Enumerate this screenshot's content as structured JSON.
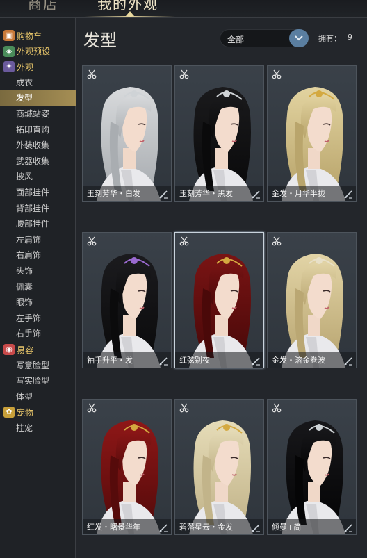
{
  "top_tabs": [
    {
      "label": "商店"
    },
    {
      "label": "我的外观"
    }
  ],
  "sidebar": {
    "categories": [
      {
        "label": "购物车",
        "icon": "cart-icon",
        "color": "#c87a3a"
      },
      {
        "label": "外观预设",
        "icon": "preset-icon",
        "color": "#4a8c5a"
      },
      {
        "label": "外观",
        "icon": "wardrobe-icon",
        "color": "#6a5a9c"
      },
      {
        "label": "易容",
        "icon": "mask-icon",
        "color": "#c84a4a"
      },
      {
        "label": "宠物",
        "icon": "pet-icon",
        "color": "#c8a03a"
      }
    ],
    "appearance_items": [
      "成衣",
      "发型",
      "商城站姿",
      "拓印直购",
      "外装收集",
      "武器收集",
      "披风",
      "面部挂件",
      "背部挂件",
      "腰部挂件",
      "左肩饰",
      "右肩饰",
      "头饰",
      "佩囊",
      "眼饰",
      "左手饰",
      "右手饰"
    ],
    "makeup_items": [
      "写意脸型",
      "写实脸型",
      "体型"
    ],
    "pet_items": [
      "挂宠"
    ],
    "active_item": "发型"
  },
  "main": {
    "title": "发型",
    "filter": {
      "value": "全部"
    },
    "owned_label": "拥有：",
    "owned_count": "9"
  },
  "cards": [
    {
      "label": "玉刻芳华・白发",
      "hair": "#d8dadc",
      "hair_dark": "#a9adb1",
      "accent": "#cfd3d6"
    },
    {
      "label": "玉刻芳华・黑发",
      "hair": "#1a1a1c",
      "hair_dark": "#0a0a0b",
      "accent": "#cfd3d6"
    },
    {
      "label": "金发・月华半拢",
      "hair": "#e2d3a0",
      "hair_dark": "#b9a56c",
      "accent": "#d4a940"
    },
    {
      "label": "袖手升平・发",
      "hair": "#1b1b1e",
      "hair_dark": "#0b0b0c",
      "accent": "#9a6ad0"
    },
    {
      "label": "红弦别夜",
      "hair": "#7a1414",
      "hair_dark": "#4a0909",
      "accent": "#d4a940"
    },
    {
      "label": "金发・溶金卷波",
      "hair": "#e2d4a6",
      "hair_dark": "#baa773",
      "accent": "#e8e0c8"
    },
    {
      "label": "红发・曙景华年",
      "hair": "#8e1717",
      "hair_dark": "#560b0b",
      "accent": "#d4a940"
    },
    {
      "label": "碧落星云・金发",
      "hair": "#e6dcb8",
      "hair_dark": "#c2b48a",
      "accent": "#d4a940"
    },
    {
      "label": "倾曼+简",
      "hair": "#17171a",
      "hair_dark": "#050506",
      "accent": "#cfd3d6"
    }
  ],
  "selected_card_index": 4
}
